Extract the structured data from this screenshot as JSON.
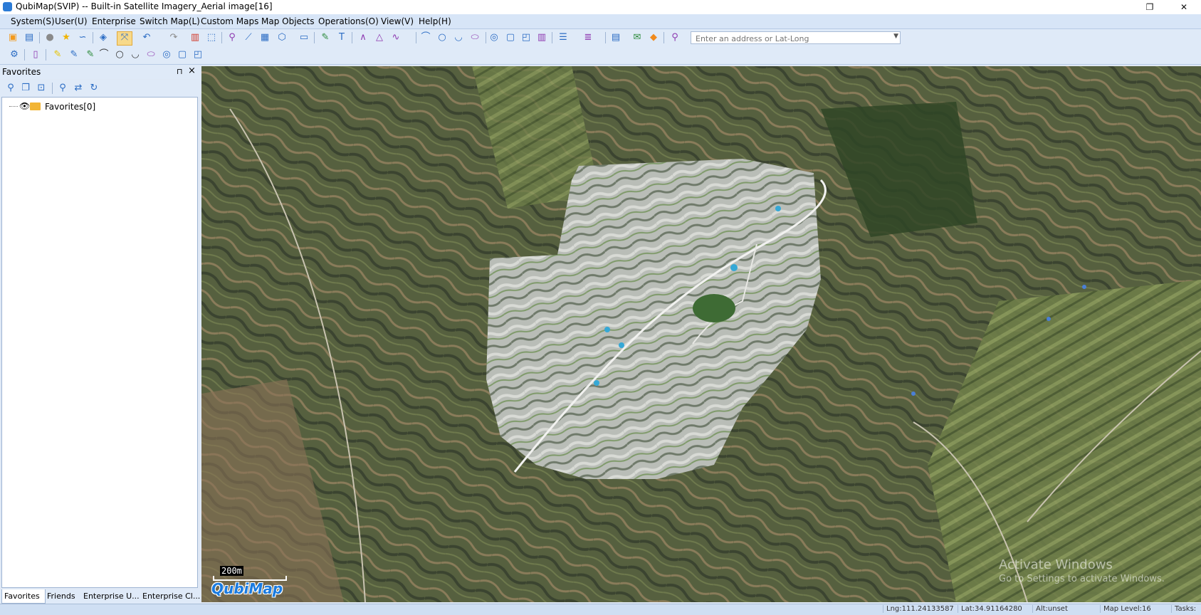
{
  "window": {
    "title": "QubiMap(SVIP) -- Built-in Satellite Imagery_Aerial image[16]",
    "restore_glyph": "❐",
    "close_glyph": "✕"
  },
  "menu": [
    "System(S)",
    "User(U)",
    "Enterprise",
    "Switch Map(L)",
    "Custom Maps",
    "Map Objects",
    "Operations(O)",
    "View(V)",
    "Help(H)"
  ],
  "search": {
    "placeholder": "Enter an address or Lat-Long",
    "value": ""
  },
  "left_panel": {
    "title": "Favorites",
    "pin_glyph": "⊓",
    "close_glyph": "×",
    "tree_item": "Favorites[0]"
  },
  "bottom_tabs": [
    "Favorites",
    "Friends",
    "Enterprise U...",
    "Enterprise Cl..."
  ],
  "map": {
    "scale_label": "200m",
    "logo": "QubiMap"
  },
  "watermark": {
    "line1": "Activate Windows",
    "line2": "Go to Settings to activate Windows."
  },
  "status": {
    "lng": "Lng:111.24133587",
    "lat": "Lat:34.91164280",
    "alt": "Alt:unset",
    "level": "Map Level:16",
    "tasks": "Tasks:"
  },
  "icons": {
    "toolbar1": [
      "new-icon",
      "save-icon",
      "user-icon",
      "star-icon",
      "route-icon",
      "layers-icon",
      "select-icon",
      "undo-icon",
      "redo-icon",
      "delete-icon",
      "rect-select-icon",
      "marker-icon",
      "ruler-icon",
      "area-icon",
      "polygon-icon",
      "screenshot-icon",
      "pin-icon",
      "text-icon",
      "polyline-icon",
      "triangle-icon",
      "curve-icon",
      "arc-icon",
      "circle-icon",
      "arc2-icon",
      "ellipse-icon",
      "circle-fill-icon",
      "rounded-rect-icon",
      "shape-icon",
      "grid-icon",
      "list-icon",
      "properties-icon",
      "chat-icon",
      "badge-icon",
      "zoom-icon"
    ],
    "toolbar2": [
      "settings-icon",
      "document-icon",
      "pin-yellow-icon",
      "pin-blue-icon",
      "pin-green-icon",
      "bridge-icon",
      "circle-icon",
      "arc-icon",
      "ellipse-icon",
      "circle-fill-icon",
      "rounded-rect-icon",
      "shape-icon"
    ]
  }
}
